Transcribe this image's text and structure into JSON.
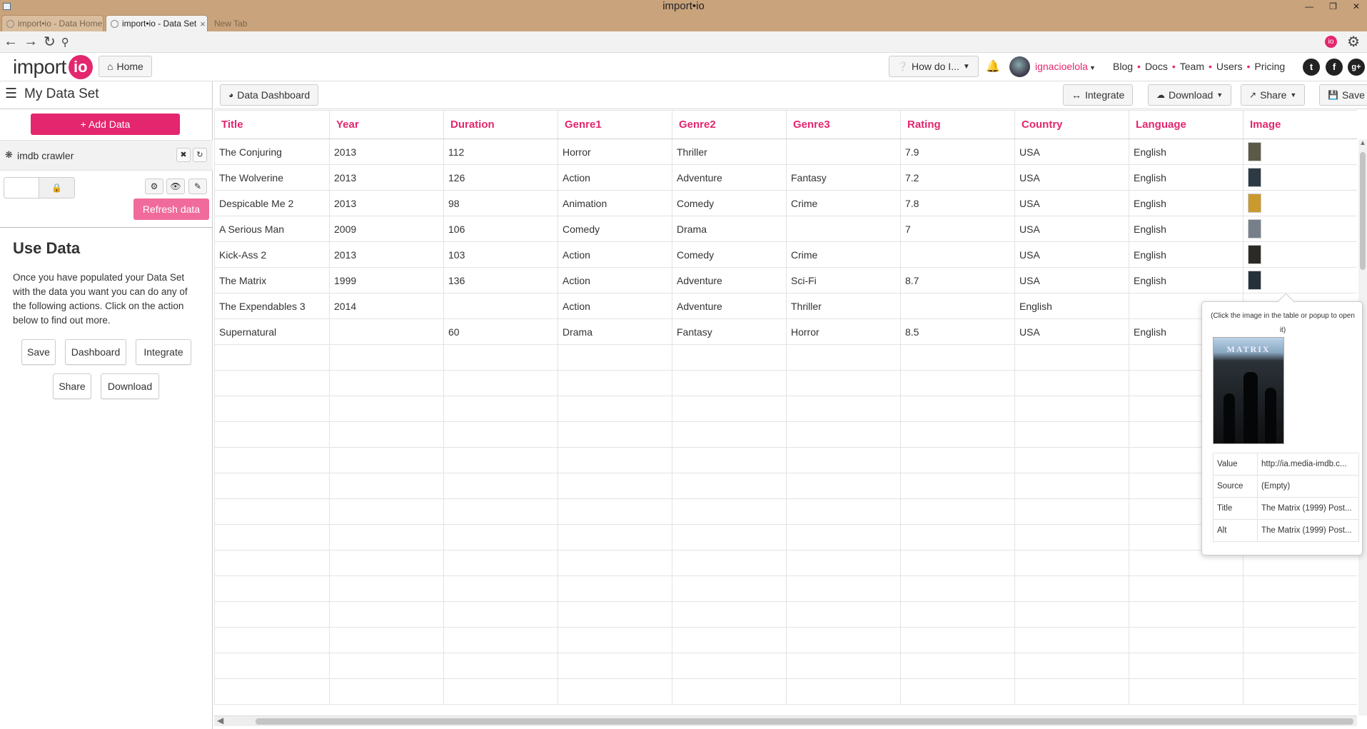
{
  "window": {
    "title": "import•io"
  },
  "browser": {
    "tabs": [
      {
        "label": "import•io - Data Home",
        "active": false
      },
      {
        "label": "import•io - Data Set",
        "active": true
      },
      {
        "label": "New Tab",
        "active": false
      }
    ]
  },
  "header": {
    "logo_word": "import",
    "logo_badge": "io",
    "home_label": "Home",
    "howdoi_label": "How do I...",
    "username": "ignacioelola",
    "nav_links": [
      "Blog",
      "Docs",
      "Team",
      "Users",
      "Pricing"
    ],
    "social": [
      "twitter",
      "facebook",
      "google-plus"
    ],
    "ext_badge": "io"
  },
  "sidebar": {
    "title": "My Data Set",
    "add_data_label": "Add Data",
    "crawler_name": "imdb crawler",
    "refresh_label": "Refresh data",
    "use_title": "Use Data",
    "use_desc": "Once you have populated your Data Set with the data you want you can do any of the following actions. Click on the action below to find out more.",
    "actions": [
      "Save",
      "Dashboard",
      "Integrate",
      "Share",
      "Download"
    ]
  },
  "toolbar": {
    "dashboard_label": "Data Dashboard",
    "integrate_label": "Integrate",
    "download_label": "Download",
    "share_label": "Share",
    "save_label": "Save"
  },
  "table": {
    "columns": [
      "Title",
      "Year",
      "Duration",
      "Genre1",
      "Genre2",
      "Genre3",
      "Rating",
      "Country",
      "Language",
      "Image"
    ],
    "rows": [
      [
        "The Conjuring",
        "2013",
        "112",
        "Horror",
        "Thriller",
        "",
        "7.9",
        "USA",
        "English",
        "thumb"
      ],
      [
        "The Wolverine",
        "2013",
        "126",
        "Action",
        "Adventure",
        "Fantasy",
        "7.2",
        "USA",
        "English",
        "thumb"
      ],
      [
        "Despicable Me 2",
        "2013",
        "98",
        "Animation",
        "Comedy",
        "Crime",
        "7.8",
        "USA",
        "English",
        "thumb"
      ],
      [
        "A Serious Man",
        "2009",
        "106",
        "Comedy",
        "Drama",
        "",
        "7",
        "USA",
        "English",
        "thumb"
      ],
      [
        "Kick-Ass 2",
        "2013",
        "103",
        "Action",
        "Comedy",
        "Crime",
        "",
        "USA",
        "English",
        "thumb"
      ],
      [
        "The Matrix",
        "1999",
        "136",
        "Action",
        "Adventure",
        "Sci-Fi",
        "8.7",
        "USA",
        "English",
        "thumb"
      ],
      [
        "The Expendables 3",
        "2014",
        "",
        "Action",
        "Adventure",
        "Thriller",
        "",
        "English",
        "",
        ""
      ],
      [
        "Supernatural",
        "",
        "60",
        "Drama",
        "Fantasy",
        "Horror",
        "8.5",
        "USA",
        "English",
        ""
      ]
    ],
    "empty_rows": 14
  },
  "popup": {
    "hint": "(Click the image in the table or popup to open it)",
    "poster_title": "MATRIX",
    "fields": [
      {
        "label": "Value",
        "value": "http://ia.media-imdb.c..."
      },
      {
        "label": "Source",
        "value": "(Empty)"
      },
      {
        "label": "Title",
        "value": "The Matrix (1999) Post..."
      },
      {
        "label": "Alt",
        "value": "The Matrix (1999) Post..."
      }
    ]
  },
  "colors": {
    "accent": "#e4266e",
    "refresh": "#f06b9b",
    "chrome": "#c9a37c"
  }
}
